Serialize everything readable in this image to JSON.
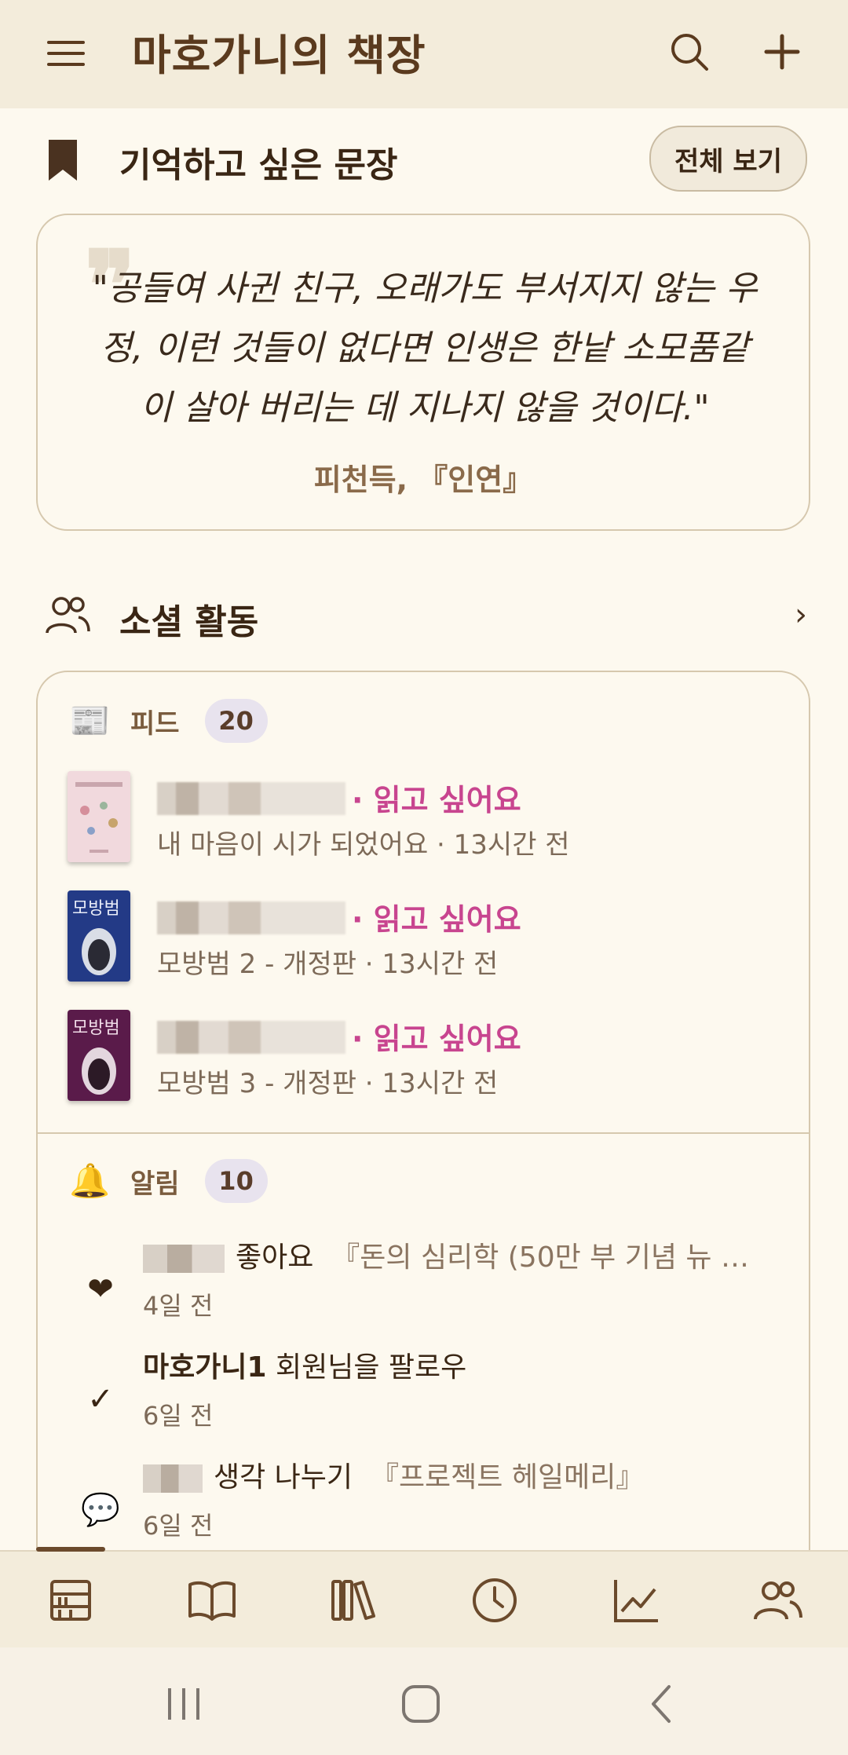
{
  "app_bar": {
    "title": "마호가니의 책장",
    "icons": [
      "menu-icon",
      "search-icon",
      "plus-icon"
    ]
  },
  "quotes_section": {
    "title": "기억하고 싶은 문장",
    "view_all": "전체 보기",
    "quote": "\"공들여 사귄 친구, 오래가도 부서지지 않는 우정, 이런 것들이 없다면 인생은 한낱 소모품같이 살아 버리는 데 지나지 않을 것이다.\"",
    "source": "피천득, 『인연』"
  },
  "social_section": {
    "title": "소셜 활동",
    "chevron": "›",
    "feed": {
      "label": "피드",
      "count": "20",
      "items": [
        {
          "action": "· 읽고 싶어요",
          "meta": "내 마음이 시가 되었어요 · 13시간 전",
          "cover_color": "#f1d9dd"
        },
        {
          "action": "· 읽고 싶어요",
          "meta": "모방범 2 - 개정판 · 13시간 전",
          "cover_color": "#233a86"
        },
        {
          "action": "· 읽고 싶어요",
          "meta": "모방범 3 - 개정판 · 13시간 전",
          "cover_color": "#5a1b4a"
        }
      ]
    },
    "notifications": {
      "label": "알림",
      "count": "10",
      "items": [
        {
          "icon": "heart-icon",
          "glyph": "❤",
          "action": "좋아요",
          "book": "『돈의 심리학 (50만 부 기념 뉴 …",
          "time": "4일 전"
        },
        {
          "icon": "check-icon",
          "glyph": "✓",
          "user": "마호가니1",
          "action": "회원님을 팔로우",
          "time": "6일 전"
        },
        {
          "icon": "speech-bubble-icon",
          "glyph": "💬",
          "action": "생각 나누기",
          "book": "『프로젝트 헤일메리』",
          "time": "6일 전"
        }
      ]
    }
  },
  "bottom_nav": {
    "items": [
      "bookshelf-icon",
      "open-book-icon",
      "library-icon",
      "clock-icon",
      "chart-icon",
      "people-icon"
    ],
    "active_index": 0
  },
  "colors": {
    "background": "#fdf9ef",
    "app_bar": "#f3ecdb",
    "brand_brown": "#5a3a1e",
    "accent_pink": "#c8458f"
  }
}
